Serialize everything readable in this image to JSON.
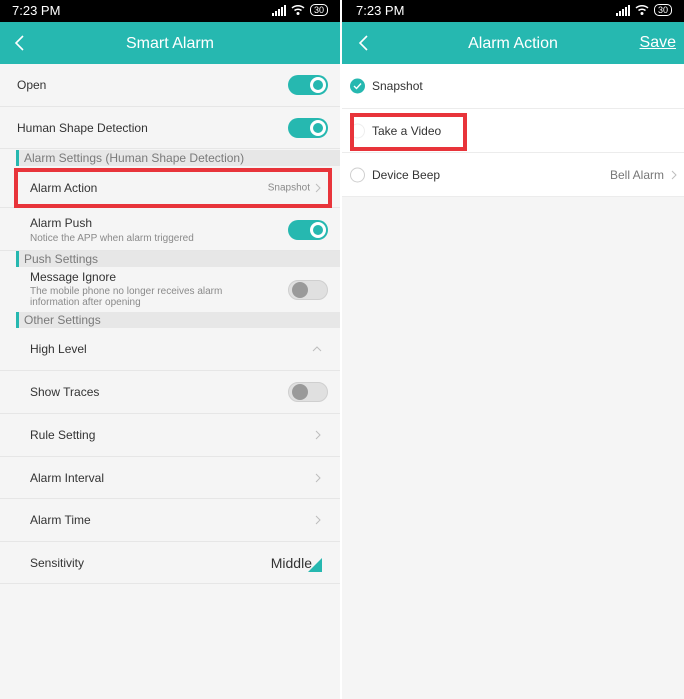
{
  "status": {
    "time": "7:23 PM",
    "battery": "30"
  },
  "left": {
    "title": "Smart Alarm",
    "open_label": "Open",
    "human_shape_label": "Human Shape Detection",
    "alarm_settings_section": "Alarm Settings (Human Shape Detection)",
    "alarm_action_label": "Alarm Action",
    "alarm_action_value": "Snapshot",
    "alarm_push_label": "Alarm Push",
    "alarm_push_sub": "Notice the APP when alarm triggered",
    "push_settings_section": "Push Settings",
    "message_ignore_label": "Message Ignore",
    "message_ignore_sub": "The mobile phone no longer receives alarm information after opening",
    "other_settings_section": "Other Settings",
    "high_level_label": "High Level",
    "show_traces_label": "Show Traces",
    "rule_setting_label": "Rule Setting",
    "alarm_interval_label": "Alarm Interval",
    "alarm_time_label": "Alarm Time",
    "sensitivity_label": "Sensitivity",
    "sensitivity_value": "Middle"
  },
  "toggles": {
    "open": true,
    "human_shape": true,
    "alarm_push": true,
    "message_ignore": false,
    "show_traces": false
  },
  "right": {
    "title": "Alarm Action",
    "save_label": "Save",
    "options": [
      {
        "label": "Snapshot",
        "checked": true
      },
      {
        "label": "Take a Video",
        "checked": false
      },
      {
        "label": "Device Beep",
        "checked": false,
        "value": "Bell Alarm"
      }
    ]
  },
  "colors": {
    "accent": "#26b8b0",
    "highlight": "#e8343a"
  },
  "icons": [
    "back-icon",
    "chevron-right-icon",
    "chevron-up-icon",
    "check-icon",
    "signal-icon",
    "wifi-icon",
    "battery-icon",
    "dropdown-corner-icon"
  ]
}
